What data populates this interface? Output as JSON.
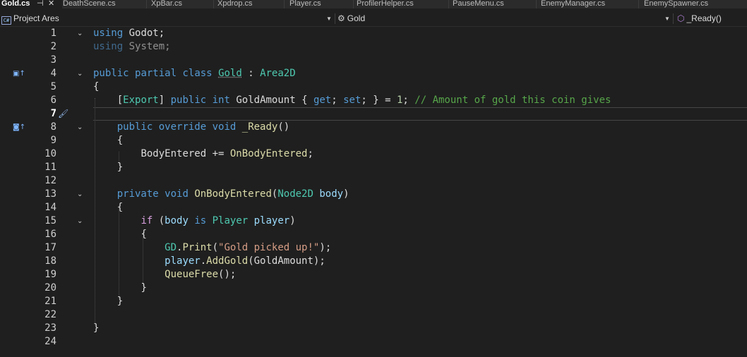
{
  "tabs": [
    {
      "label": "Gold.cs",
      "active": true,
      "pin": "⊣",
      "close": "✕"
    },
    {
      "label": "DeathScene.cs"
    },
    {
      "label": "XpBar.cs"
    },
    {
      "label": "Xpdrop.cs"
    },
    {
      "label": "Player.cs"
    },
    {
      "label": "ProfilerHelper.cs"
    },
    {
      "label": "PauseMenu.cs"
    },
    {
      "label": "EnemyManager.cs"
    },
    {
      "label": "EnemySpawner.cs"
    }
  ],
  "nav": {
    "project": "Project Ares",
    "project_icon": "C#",
    "type": "Gold",
    "member": "_Ready()",
    "dropdown_arrow": "▼"
  },
  "gutter": {
    "line_numbers": [
      "1",
      "2",
      "3",
      "4",
      "5",
      "6",
      "7",
      "8",
      "9",
      "10",
      "11",
      "12",
      "13",
      "14",
      "15",
      "16",
      "17",
      "18",
      "19",
      "20",
      "21",
      "22",
      "23",
      "24"
    ],
    "current_line": "7"
  },
  "colors": {
    "keyword": "#569cd6",
    "control": "#d8a0df",
    "type": "#4ec9b0",
    "method": "#dcdcaa",
    "variable": "#9cdcfe",
    "string": "#d69d85",
    "number": "#b5cea8",
    "comment": "#57a64a",
    "background": "#1f1f1f"
  },
  "code": {
    "l1": {
      "kw": "using",
      "ns": "Godot",
      "semi": ";"
    },
    "l2": {
      "kw": "using",
      "ns": "System",
      "semi": ";"
    },
    "l4": {
      "k1": "public",
      "k2": "partial",
      "k3": "class",
      "name": "Gold",
      "colon": " : ",
      "base": "Area2D"
    },
    "l5": {
      "text": "{"
    },
    "l6": {
      "ob": "[",
      "attr": "Export",
      "cb": "]",
      "k1": "public",
      "k2": "int",
      "name": "GoldAmount",
      "p1": " { ",
      "get": "get",
      "p2": "; ",
      "set": "set",
      "p3": "; } = ",
      "num": "1",
      "p4": "; ",
      "comment": "// Amount of gold this coin gives"
    },
    "l8": {
      "k1": "public",
      "k2": "override",
      "k3": "void",
      "name": "_Ready",
      "rest": "()"
    },
    "l9": {
      "text": "{"
    },
    "l10": {
      "ev": "BodyEntered",
      "op": " += ",
      "handler": "OnBodyEntered",
      "semi": ";"
    },
    "l11": {
      "text": "}"
    },
    "l13": {
      "k1": "private",
      "k2": "void",
      "name": "OnBodyEntered",
      "p1": "(",
      "type": "Node2D",
      "param": "body",
      "p2": ")"
    },
    "l14": {
      "text": "{"
    },
    "l15": {
      "kw": "if",
      "p1": " (",
      "v1": "body",
      "is": "is",
      "type": "Player",
      "v2": "player",
      "p2": ")"
    },
    "l16": {
      "text": "{"
    },
    "l17": {
      "cls": "GD",
      "dot": ".",
      "method": "Print",
      "p1": "(",
      "str": "\"Gold picked up!\"",
      "p2": ");"
    },
    "l18": {
      "obj": "player",
      "dot": ".",
      "method": "AddGold",
      "arg": "(GoldAmount);"
    },
    "l19": {
      "method": "QueueFree",
      "rest": "();"
    },
    "l20": {
      "text": "}"
    },
    "l21": {
      "text": "}"
    },
    "l23": {
      "text": "}"
    }
  },
  "icons": {
    "fold": "fold-chevron-icon",
    "margin_class": "class-inheritance-icon",
    "margin_method": "override-method-icon",
    "quick_action": "screwdriver-brush-icon"
  }
}
